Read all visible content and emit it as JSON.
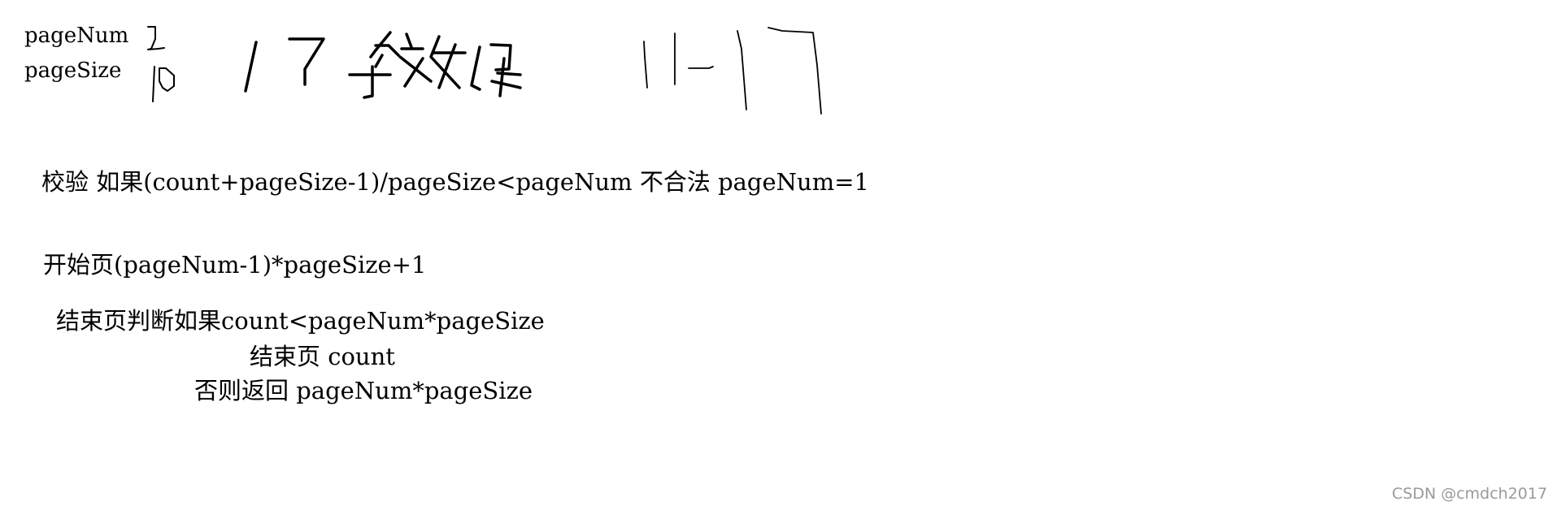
{
  "labels": {
    "page_num": "pageNum",
    "page_size": "pageSize"
  },
  "handwriting": {
    "page_num_value": "1",
    "page_size_value": "10",
    "total_note": "17条数据",
    "range_note": "11-17"
  },
  "lines": [
    "校验 如果(count+pageSize-1)/pageSize<pageNum 不合法 pageNum=1",
    "开始页(pageNum-1)*pageSize+1",
    "结束页判断如果count<pageNum*pageSize",
    "结束页 count",
    "否则返回 pageNum*pageSize"
  ],
  "watermark": "CSDN @cmdch2017"
}
